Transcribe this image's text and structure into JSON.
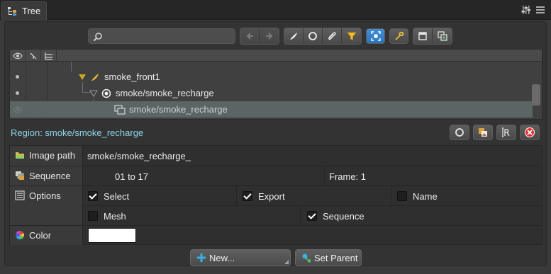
{
  "tab": {
    "title": "Tree"
  },
  "toolbar": {
    "search_placeholder": ""
  },
  "tree": {
    "rows": [
      {
        "label": "smoke_front1"
      },
      {
        "label": "smoke/smoke_recharge"
      },
      {
        "label": "smoke/smoke_recharge"
      }
    ]
  },
  "region": {
    "title": "Region: smoke/smoke_recharge"
  },
  "properties": {
    "image_path": {
      "label": "Image path",
      "value": "smoke/smoke_recharge_"
    },
    "sequence": {
      "label": "Sequence",
      "range": "01  to  17",
      "frame": "Frame:  1"
    },
    "options": {
      "label": "Options",
      "select": {
        "label": "Select",
        "checked": true
      },
      "export": {
        "label": "Export",
        "checked": true
      },
      "name": {
        "label": "Name",
        "checked": false
      },
      "mesh": {
        "label": "Mesh",
        "checked": false
      },
      "sequence": {
        "label": "Sequence",
        "checked": true
      }
    },
    "color": {
      "label": "Color",
      "value": "#ffffff"
    }
  },
  "buttons": {
    "new_label": "New...",
    "set_parent_label": "Set Parent"
  },
  "colors": {
    "accent_blue": "#2d74b8",
    "region_text": "#8fd4e8",
    "selected_row": "#5b6564"
  }
}
